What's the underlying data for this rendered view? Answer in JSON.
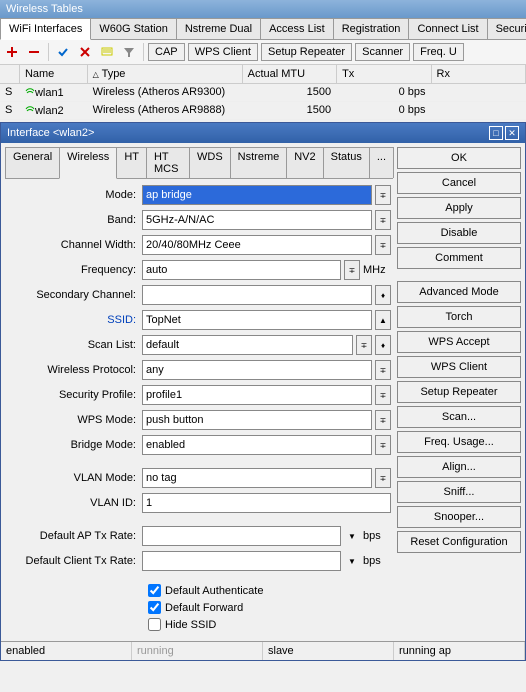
{
  "window_title": "Wireless Tables",
  "main_tabs": [
    "WiFi Interfaces",
    "W60G Station",
    "Nstreme Dual",
    "Access List",
    "Registration",
    "Connect List",
    "Security Profiles"
  ],
  "main_tabs_active": 0,
  "toolbar_text_buttons": [
    "CAP",
    "WPS Client",
    "Setup Repeater",
    "Scanner",
    "Freq. U"
  ],
  "list_headers": [
    "",
    "Name",
    "Type",
    "Actual MTU",
    "Tx",
    "Rx"
  ],
  "list_rows": [
    {
      "s": "S",
      "name": "wlan1",
      "type": "Wireless (Atheros AR9300)",
      "mtu": "1500",
      "tx": "0 bps",
      "rx": ""
    },
    {
      "s": "S",
      "name": "wlan2",
      "type": "Wireless (Atheros AR9888)",
      "mtu": "1500",
      "tx": "0 bps",
      "rx": ""
    }
  ],
  "sub_window_title": "Interface <wlan2>",
  "sub_tabs": [
    "General",
    "Wireless",
    "HT",
    "HT MCS",
    "WDS",
    "Nstreme",
    "NV2",
    "Status",
    "..."
  ],
  "sub_tabs_active": 1,
  "form": {
    "mode": {
      "label": "Mode:",
      "value": "ap bridge"
    },
    "band": {
      "label": "Band:",
      "value": "5GHz-A/N/AC"
    },
    "channel_width": {
      "label": "Channel Width:",
      "value": "20/40/80MHz Ceee"
    },
    "frequency": {
      "label": "Frequency:",
      "value": "auto",
      "unit": "MHz"
    },
    "secondary_channel": {
      "label": "Secondary Channel:",
      "value": ""
    },
    "ssid": {
      "label": "SSID:",
      "value": "TopNet"
    },
    "scan_list": {
      "label": "Scan List:",
      "value": "default"
    },
    "wireless_protocol": {
      "label": "Wireless Protocol:",
      "value": "any"
    },
    "security_profile": {
      "label": "Security Profile:",
      "value": "profile1"
    },
    "wps_mode": {
      "label": "WPS Mode:",
      "value": "push button"
    },
    "bridge_mode": {
      "label": "Bridge Mode:",
      "value": "enabled"
    },
    "vlan_mode": {
      "label": "VLAN Mode:",
      "value": "no tag"
    },
    "vlan_id": {
      "label": "VLAN ID:",
      "value": "1"
    },
    "default_ap_tx": {
      "label": "Default AP Tx Rate:",
      "value": "",
      "unit": "bps"
    },
    "default_client_tx": {
      "label": "Default Client Tx Rate:",
      "value": "",
      "unit": "bps"
    }
  },
  "checkboxes": [
    {
      "label": "Default Authenticate",
      "checked": true
    },
    {
      "label": "Default Forward",
      "checked": true
    },
    {
      "label": "Hide SSID",
      "checked": false
    }
  ],
  "right_buttons_1": [
    "OK",
    "Cancel",
    "Apply",
    "Disable",
    "Comment"
  ],
  "right_buttons_2": [
    "Advanced Mode",
    "Torch",
    "WPS Accept",
    "WPS Client",
    "Setup Repeater",
    "Scan...",
    "Freq. Usage...",
    "Align...",
    "Sniff...",
    "Snooper...",
    "Reset Configuration"
  ],
  "status_cells": [
    "enabled",
    "running",
    "slave",
    "running ap"
  ]
}
